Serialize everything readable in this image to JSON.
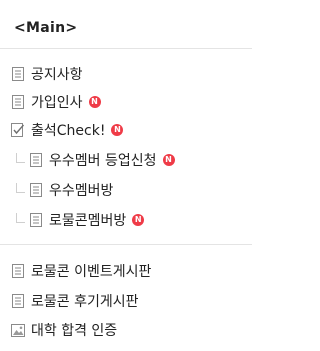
{
  "header": {
    "title": "<Main>"
  },
  "menu": {
    "group1": [
      {
        "label": "공지사항",
        "icon": "document-icon",
        "new": false
      },
      {
        "label": "가입인사",
        "icon": "document-icon",
        "new": true
      },
      {
        "label": "출석Check!",
        "icon": "checklist-icon",
        "new": true
      },
      {
        "label": "우수멤버 등업신청",
        "icon": "document-icon",
        "new": true,
        "sub": true
      },
      {
        "label": "우수멤버방",
        "icon": "document-icon",
        "new": false,
        "sub": true
      },
      {
        "label": "로물콘멤버방",
        "icon": "document-icon",
        "new": true,
        "sub": true
      }
    ],
    "group2": [
      {
        "label": "로물콘 이벤트게시판",
        "icon": "document-icon",
        "new": false
      },
      {
        "label": "로물콘 후기게시판",
        "icon": "document-icon",
        "new": false
      },
      {
        "label": "대학 합격 인증",
        "icon": "image-icon",
        "new": false
      }
    ]
  },
  "badge_text": "N",
  "colors": {
    "badge": "#ef3b47",
    "icon": "#8a8a8a",
    "separator": "#e4e4e4"
  }
}
